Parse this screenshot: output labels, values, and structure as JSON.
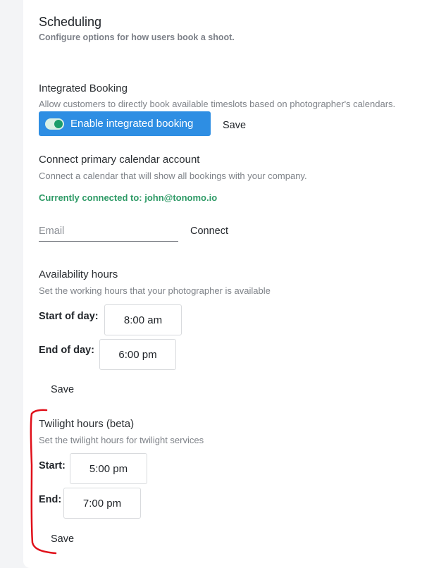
{
  "header": {
    "title": "Scheduling",
    "subtitle": "Configure options for how users book a shoot."
  },
  "integrated_booking": {
    "title": "Integrated Booking",
    "description": "Allow customers to directly book available timeslots based on photographer's calendars.",
    "toggle_label": "Enable integrated booking",
    "toggle_on": true,
    "save_label": "Save"
  },
  "calendar": {
    "title": "Connect primary calendar account",
    "description": "Connect a calendar that will show all bookings with your company.",
    "connected_text": "Currently connected to: john@tonomo.io",
    "email_placeholder": "Email",
    "email_value": "",
    "connect_label": "Connect"
  },
  "availability": {
    "title": "Availability hours",
    "description": "Set the working hours that your photographer is available",
    "start_label": "Start of day:",
    "start_value": "8:00 am",
    "end_label": "End of day:",
    "end_value": "6:00 pm",
    "save_label": "Save"
  },
  "twilight": {
    "title": "Twilight hours (beta)",
    "description": "Set the twilight hours for twilight services",
    "start_label": "Start:",
    "start_value": "5:00 pm",
    "end_label": "End:",
    "end_value": "7:00 pm",
    "save_label": "Save"
  },
  "colors": {
    "accent": "#2e8ee3",
    "connected": "#2e9a66",
    "annotation": "#e0101a"
  }
}
